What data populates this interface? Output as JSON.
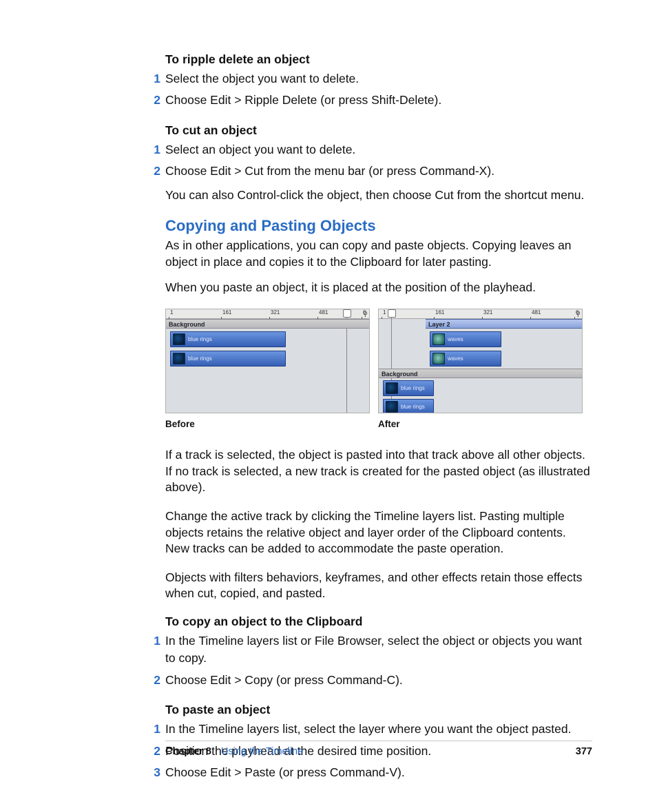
{
  "sections": {
    "ripple_delete": {
      "heading": "To ripple delete an object",
      "steps": [
        "Select the object you want to delete.",
        "Choose Edit > Ripple Delete (or press Shift-Delete)."
      ]
    },
    "cut_object": {
      "heading": "To cut an object",
      "steps": [
        "Select an object you want to delete.",
        "Choose Edit > Cut from the menu bar (or press Command-X)."
      ],
      "note": "You can also Control-click the object, then choose Cut from the shortcut menu."
    },
    "copy_paste_section": {
      "title": "Copying and Pasting Objects",
      "para1": "As in other applications, you can copy and paste objects. Copying leaves an object in place and copies it to the Clipboard for later pasting.",
      "para2": "When you paste an object, it is placed at the position of the playhead.",
      "fig_before": "Before",
      "fig_after": "After",
      "para3": "If a track is selected, the object is pasted into that track above all other objects. If no track is selected, a new track is created for the pasted object (as illustrated above).",
      "para4": "Change the active track by clicking the Timeline layers list. Pasting multiple objects retains the relative object and layer order of the Clipboard contents. New tracks can be added to accommodate the paste operation.",
      "para5": "Objects with filters behaviors, keyframes, and other effects retain those effects when cut, copied, and pasted."
    },
    "copy_clipboard": {
      "heading": "To copy an object to the Clipboard",
      "steps": [
        "In the Timeline layers list or File Browser, select the object or objects you want to copy.",
        "Choose Edit > Copy (or press Command-C)."
      ]
    },
    "paste_object": {
      "heading": "To paste an object",
      "steps": [
        "In the Timeline layers list, select the layer where you want the object pasted.",
        "Position the playhead at the desired time position.",
        "Choose Edit > Paste (or press Command-V)."
      ]
    }
  },
  "timeline_fig": {
    "ticks": [
      "1",
      "161",
      "321",
      "481",
      "6"
    ],
    "background_label": "Background",
    "layer2_label": "Layer 2",
    "clip_blue": "blue rings",
    "clip_waves": "waves"
  },
  "footer": {
    "chapter": "Chapter 8",
    "title": "Using the Timeline",
    "page": "377"
  },
  "step_numbers": {
    "n1": "1",
    "n2": "2",
    "n3": "3"
  }
}
